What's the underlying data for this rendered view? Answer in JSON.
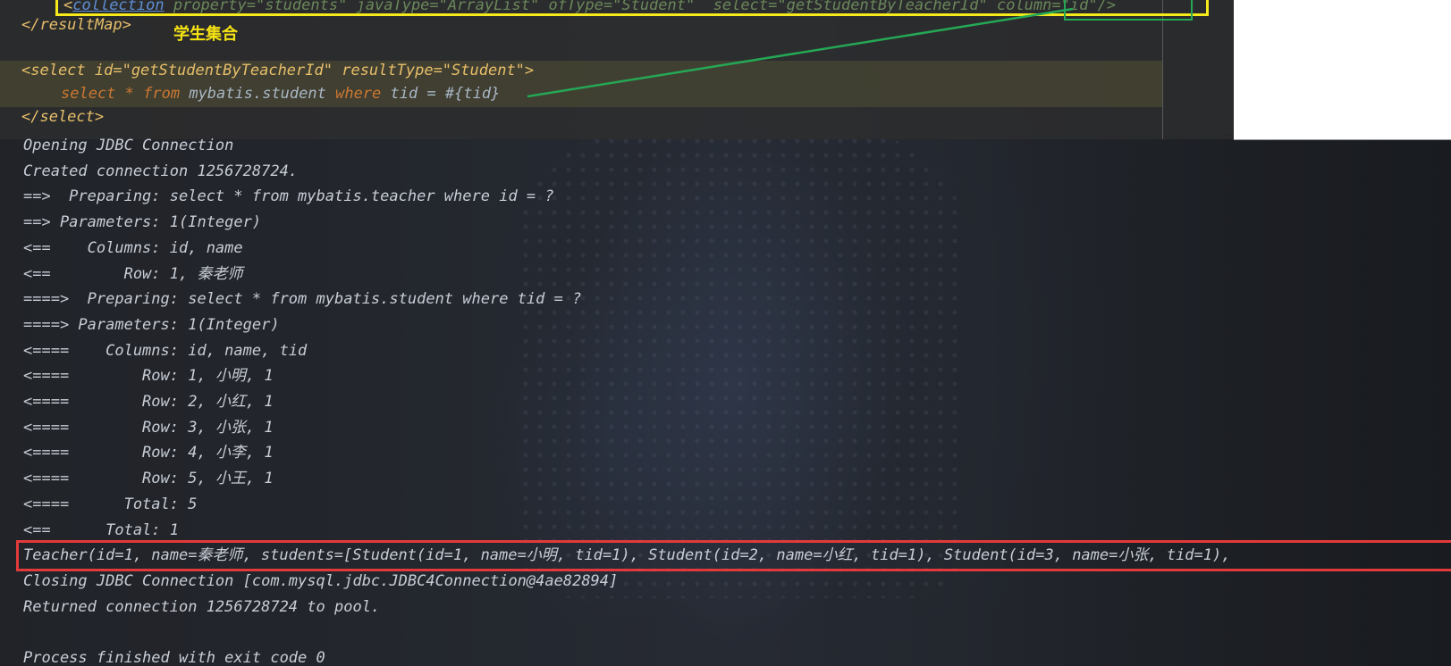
{
  "editor": {
    "collection_line": {
      "open": "<",
      "tag": "collection",
      "rest": " property=\"students\" javaType=\"ArrayList\" ofType=\"Student\"  select=\"getStudentByTeacherId\" column=\"id\"/>"
    },
    "result_map_close": "</resultMap>",
    "annotation": "学生集合",
    "select_open": "<select id=\"getStudentByTeacherId\" resultType=\"Student\">",
    "sql_line": {
      "kw1": "select",
      "star": " * ",
      "kw2": "from",
      "rest": " mybatis.student ",
      "kw3": "where",
      "cond": " tid = #{tid}"
    },
    "select_close": "</select>"
  },
  "console": {
    "lines": [
      "Opening JDBC Connection",
      "Created connection 1256728724.",
      "==>  Preparing: select * from mybatis.teacher where id = ?",
      "==> Parameters: 1(Integer)",
      "<==    Columns: id, name",
      "<==        Row: 1, 秦老师",
      "====>  Preparing: select * from mybatis.student where tid = ?",
      "====> Parameters: 1(Integer)",
      "<====    Columns: id, name, tid",
      "<====        Row: 1, 小明, 1",
      "<====        Row: 2, 小红, 1",
      "<====        Row: 3, 小张, 1",
      "<====        Row: 4, 小李, 1",
      "<====        Row: 5, 小王, 1",
      "<====      Total: 5",
      "<==      Total: 1",
      "Teacher(id=1, name=秦老师, students=[Student(id=1, name=小明, tid=1), Student(id=2, name=小红, tid=1), Student(id=3, name=小张, tid=1),",
      "Closing JDBC Connection [com.mysql.jdbc.JDBC4Connection@4ae82894]",
      "Returned connection 1256728724 to pool.",
      "",
      "Process finished with exit code 0"
    ]
  },
  "colors": {
    "highlight_yellow": "#f7ea1b",
    "highlight_green": "#25a855",
    "highlight_red": "#e23a3a",
    "xml_tag": "#e8bf6a",
    "xml_value": "#6a8759",
    "sql_keyword": "#cc7832"
  }
}
